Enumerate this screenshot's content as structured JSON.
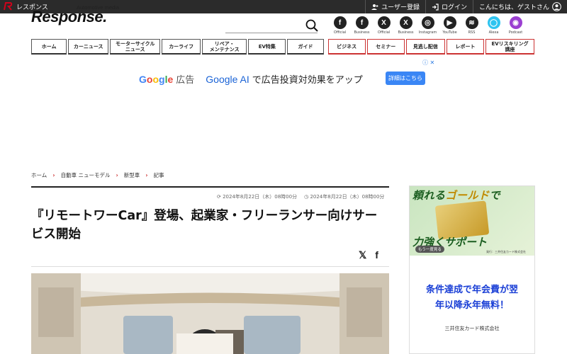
{
  "topbar": {
    "site_name": "レスポンス",
    "register": "ユーザー登録",
    "login": "ログイン",
    "greeting": "こんにちは、ゲストさん"
  },
  "header": {
    "logo_text": "Response.",
    "tagline": "Automotive media"
  },
  "social": [
    {
      "glyph": "f",
      "label": "Official",
      "icon": "facebook-icon"
    },
    {
      "glyph": "f",
      "label": "Business",
      "icon": "facebook-icon"
    },
    {
      "glyph": "X",
      "label": "Official",
      "icon": "x-icon"
    },
    {
      "glyph": "X",
      "label": "Business",
      "icon": "x-icon"
    },
    {
      "glyph": "◎",
      "label": "Instagram",
      "icon": "instagram-icon"
    },
    {
      "glyph": "▶",
      "label": "YouTube",
      "icon": "youtube-icon"
    },
    {
      "glyph": "≋",
      "label": "RSS",
      "icon": "rss-icon"
    },
    {
      "glyph": "◯",
      "label": "Alexa",
      "icon": "alexa-icon"
    },
    {
      "glyph": "◉",
      "label": "Podcast",
      "icon": "podcast-icon"
    }
  ],
  "nav": [
    {
      "label": "ホーム"
    },
    {
      "label": "カーニュース"
    },
    {
      "label": "モーターサイクル\nニュース"
    },
    {
      "label": "カーライフ"
    },
    {
      "label": "リペア・\nメンテナンス"
    },
    {
      "label": "EV特集"
    },
    {
      "label": "ガイド"
    },
    {
      "label": "ビジネス"
    },
    {
      "label": "セミナー"
    },
    {
      "label": "見逃し配信"
    },
    {
      "label": "レポート"
    },
    {
      "label": "EVリスキリング\n講座"
    }
  ],
  "ad": {
    "google_word": "Google",
    "ad_word": "広告",
    "google_ai": "Google AI",
    "message": "で広告投資対効果をアップ",
    "button": "詳細はこちら"
  },
  "breadcrumb": [
    "ホーム",
    "自動車 ニューモデル",
    "新型車",
    "記事"
  ],
  "article": {
    "published": "2024年8月22日（木）08時00分",
    "updated": "2024年8月22日（木）08時00分",
    "title": "『リモートワーCar』登場、起業家・フリーランサー向けサービス開始"
  },
  "side_ad": {
    "headline_1": "頼れる",
    "headline_gold": "ゴールド",
    "headline_2": "で",
    "headline_bottom": "力強くサポート",
    "more": "もう一度見る",
    "fine_print": "発行：三井住友カード株式会社",
    "promo_line1": "条件達成で年会費が翌",
    "promo_line2": "年以降永年無料！",
    "company": "三井住友カード株式会社"
  },
  "colors": {
    "accent_red": "#d0021b",
    "ad_button_blue": "#3a86f5",
    "promo_blue": "#1a3fd6"
  }
}
